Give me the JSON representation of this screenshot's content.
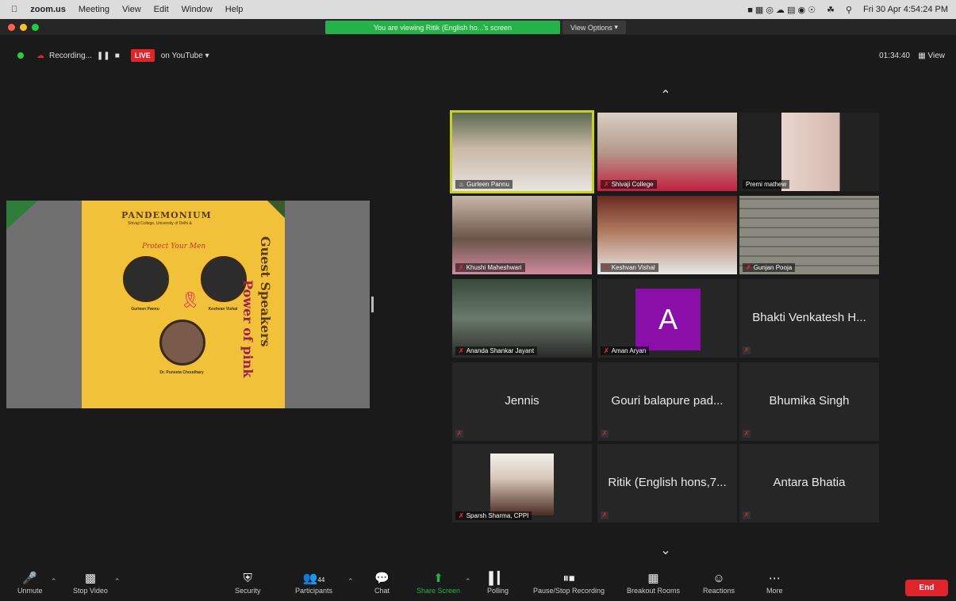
{
  "menubar": {
    "app": "zoom.us",
    "items": [
      "Meeting",
      "View",
      "Edit",
      "Window",
      "Help"
    ],
    "clock": "Fri 30 Apr 4:54:24 PM"
  },
  "share_banner": "You are viewing Ritik (English ho...'s screen",
  "view_options": "View Options",
  "topbar": {
    "recording": "Recording...",
    "live": "LIVE",
    "on_youtube": "on YouTube",
    "timer": "01:34:40",
    "view": "View"
  },
  "poster": {
    "title": "PANDEMONIUM",
    "subtitle": "Shivaji College, University of Delhi &",
    "theme": "Protect Your Men",
    "speaker1_name": "Gurleen Pannu",
    "speaker2_name": "Keshvan Vishal",
    "speaker3_name": "Dr. Puneeta Choudhary",
    "vertical1": "Guest Speakers",
    "vertical2": "Power of pink"
  },
  "participants": [
    {
      "name": "Gurleen Pannu",
      "type": "video",
      "active": true,
      "muted": false
    },
    {
      "name": "Shivaji College",
      "type": "video",
      "muted": true
    },
    {
      "name": "Premi mathew",
      "type": "video",
      "muted": false
    },
    {
      "name": "Khushi Maheshwari",
      "type": "video",
      "muted": true
    },
    {
      "name": "Keshvan Vishal",
      "type": "video",
      "muted": true
    },
    {
      "name": "Gunjan Pooja",
      "type": "video",
      "muted": true
    },
    {
      "name": "Ananda Shankar Jayant",
      "type": "video",
      "muted": true
    },
    {
      "name": "Aman Aryan",
      "type": "avatar",
      "initial": "A",
      "muted": true
    },
    {
      "name": "Bhakti Venkatesh H...",
      "type": "text",
      "muted": true
    },
    {
      "name": "Jennis",
      "type": "text",
      "muted": true
    },
    {
      "name": "Gouri balapure pad...",
      "type": "text",
      "muted": true
    },
    {
      "name": "Bhumika Singh",
      "type": "text",
      "muted": true
    },
    {
      "name": "Sparsh Sharma, CPPI",
      "type": "photo",
      "muted": true
    },
    {
      "name": "Ritik (English hons,7...",
      "type": "text",
      "muted": true
    },
    {
      "name": "Antara Bhatia",
      "type": "text",
      "muted": true
    }
  ],
  "toolbar": {
    "unmute": "Unmute",
    "stop_video": "Stop Video",
    "security": "Security",
    "participants": "Participants",
    "participants_count": "44",
    "chat": "Chat",
    "share_screen": "Share Screen",
    "polling": "Polling",
    "pause_recording": "Pause/Stop Recording",
    "breakout": "Breakout Rooms",
    "reactions": "Reactions",
    "more": "More",
    "end": "End"
  },
  "colors": {
    "accent_green": "#27b14a",
    "end_red": "#e0242b",
    "active_speaker": "#c9d11f",
    "avatar_purple": "#8a0fa8",
    "poster_yellow": "#f2c13a"
  }
}
